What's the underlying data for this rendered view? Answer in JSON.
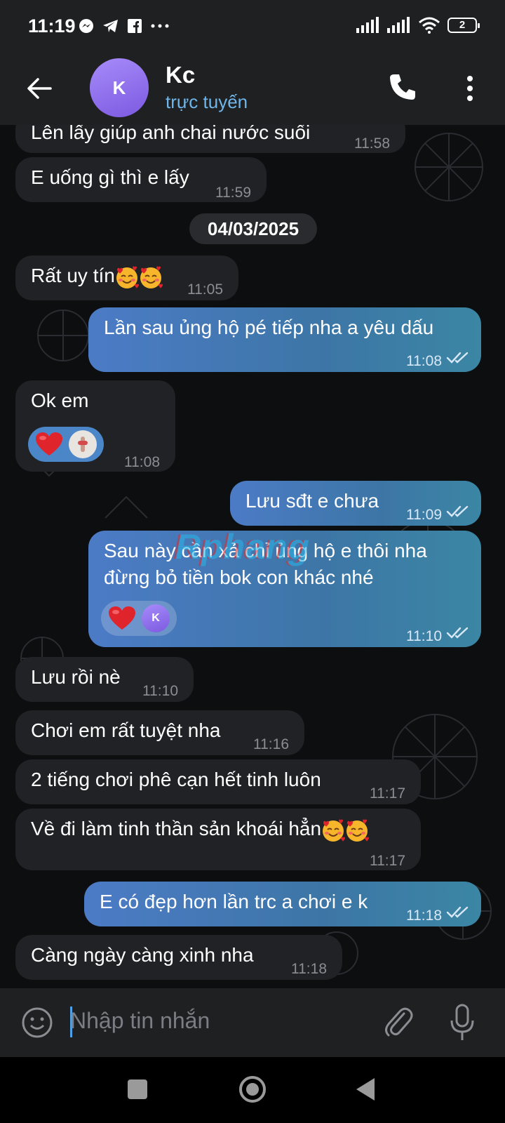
{
  "status_bar": {
    "time": "11:19",
    "battery": "2"
  },
  "header": {
    "avatar_letter": "K",
    "name": "Kc",
    "status": "trực tuyến"
  },
  "date_separator": "04/03/2025",
  "messages": [
    {
      "text": "Lên lấy giúp anh chai nước suối",
      "time": "11:58"
    },
    {
      "text": "E uống gì thì e lấy",
      "time": "11:59"
    },
    {
      "text": "Rất uy tín",
      "time": "11:05"
    },
    {
      "text": "Lần sau ủng hộ pé tiếp nha a yêu dấu",
      "time": "11:08"
    },
    {
      "text": "Ok em",
      "time": "11:08"
    },
    {
      "text": "Lưu sđt e chưa",
      "time": "11:09"
    },
    {
      "text": "Sau này cần xả chỉ ủng hộ e thôi nha",
      "text2": "đừng bỏ tiền bok con khác nhé",
      "time": "11:10",
      "reactor": "K"
    },
    {
      "text": "Lưu rồi nè",
      "time": "11:10"
    },
    {
      "text": "Chơi em rất tuyệt nha",
      "time": "11:16"
    },
    {
      "text": "2 tiếng chơi phê cạn hết tinh luôn",
      "time": "11:17"
    },
    {
      "text": "Về đi làm tinh thần sản khoái hẳn",
      "time": "11:17"
    },
    {
      "text": "E có đẹp hơn lần trc a chơi e k",
      "time": "11:18"
    },
    {
      "text": "Càng ngày càng xinh nha",
      "time": "11:18"
    }
  ],
  "watermark": "Rphang",
  "composer": {
    "placeholder": "Nhập tin nhắn"
  },
  "colors": {
    "accent": "#6fb6ea",
    "outgoing": "#4c7bc6",
    "incoming": "#212226",
    "heart": "#e0242b"
  },
  "icons": [
    "back-arrow-icon",
    "phone-icon",
    "more-vert-icon",
    "emoji-icon",
    "attach-icon",
    "mic-icon",
    "double-check-icon",
    "heart-icon",
    "smiling-face-with-hearts-emoji"
  ]
}
